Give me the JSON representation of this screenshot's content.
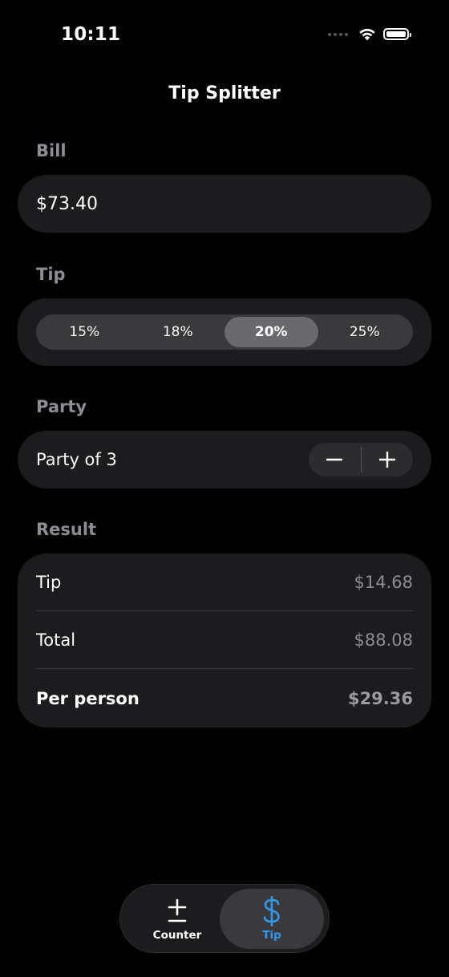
{
  "status": {
    "time": "10:11",
    "icons": [
      "signal-dots-icon",
      "wifi-icon",
      "battery-icon"
    ]
  },
  "nav": {
    "title": "Tip Splitter"
  },
  "bill": {
    "header": "Bill",
    "value": "$73.40"
  },
  "tip": {
    "header": "Tip",
    "options": [
      "15%",
      "18%",
      "20%",
      "25%"
    ],
    "selected": "20%"
  },
  "party": {
    "header": "Party",
    "label": "Party of 3",
    "decrement_icon": "minus-icon",
    "increment_icon": "plus-icon"
  },
  "result": {
    "header": "Result",
    "rows": [
      {
        "label": "Tip",
        "value": "$14.68"
      },
      {
        "label": "Total",
        "value": "$88.08"
      },
      {
        "label": "Per person",
        "value": "$29.36"
      }
    ]
  },
  "tabbar": {
    "tabs": [
      {
        "label": "Counter",
        "icon": "plus-minus-icon"
      },
      {
        "label": "Tip",
        "icon": "dollar-icon"
      }
    ],
    "selected": "Tip",
    "accent_color": "#2f9bf0"
  }
}
